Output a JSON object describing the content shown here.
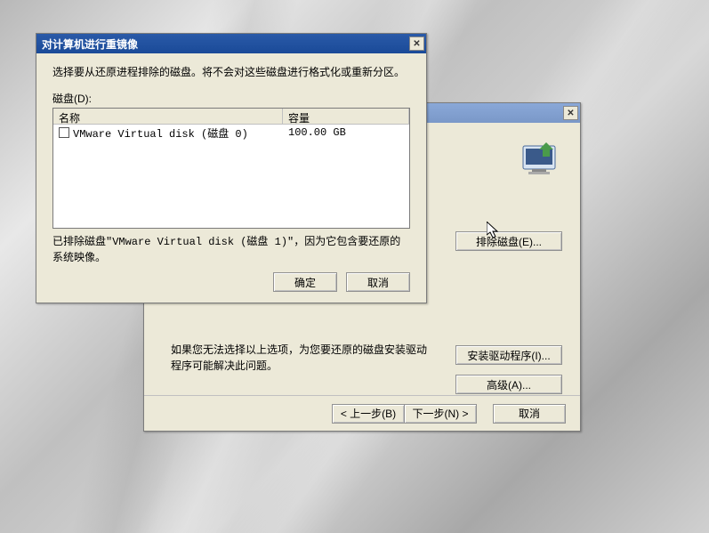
{
  "dialog": {
    "title": "对计算机进行重镜像",
    "instruction": "选择要从还原进程排除的磁盘。将不会对这些磁盘进行格式化或重新分区。",
    "disk_label": "磁盘(D):",
    "columns": {
      "name": "名称",
      "size": "容量"
    },
    "rows": [
      {
        "checked": false,
        "name": "VMware Virtual disk (磁盘 0)",
        "size": "100.00 GB"
      }
    ],
    "excluded_msg": "已排除磁盘\"VMware Virtual disk (磁盘 1)\"，因为它包含要还原的系统映像。",
    "ok": "确定",
    "cancel": "取消"
  },
  "parent": {
    "exclude_btn": "排除磁盘(E)...",
    "help_text": "如果您无法选择以上选项，为您要还原的磁盘安装驱动程序可能解决此问题。",
    "install_btn": "安装驱动程序(I)...",
    "advanced_btn": "高级(A)...",
    "back": "< 上一步(B)",
    "next": "下一步(N) >",
    "cancel": "取消"
  }
}
